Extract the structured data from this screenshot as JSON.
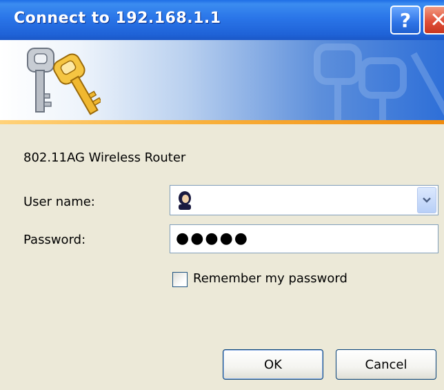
{
  "window": {
    "title": "Connect to 192.168.1.1",
    "help_label": "?",
    "close_label": "✕"
  },
  "banner": {
    "icon": "keys-icon",
    "accent_color": "#f08c0f"
  },
  "form": {
    "realm": "802.11AG Wireless Router",
    "user_label": "User name:",
    "user_value": "",
    "password_label": "Password:",
    "password_value": "●●●●●",
    "remember_label": "Remember my password",
    "remember_checked": false
  },
  "buttons": {
    "ok": "OK",
    "cancel": "Cancel"
  }
}
